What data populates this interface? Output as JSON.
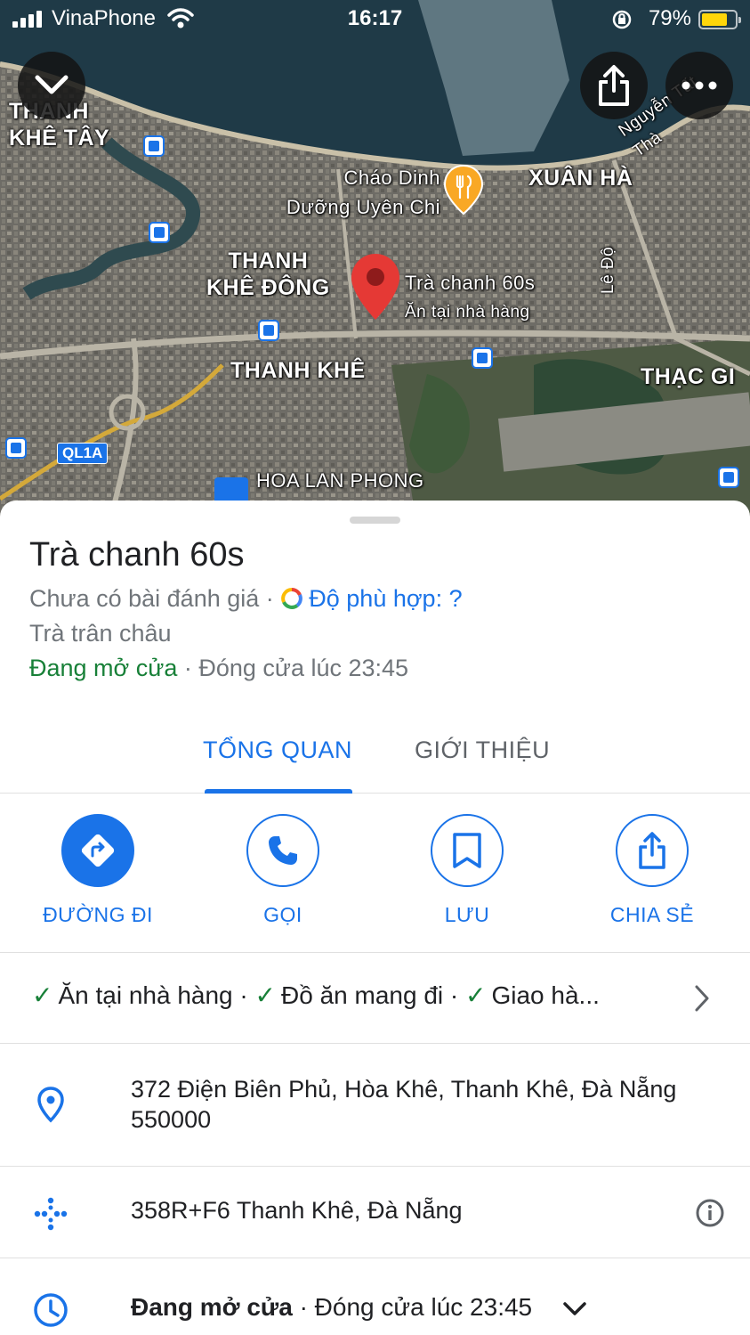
{
  "status_bar": {
    "carrier": "VinaPhone",
    "time": "16:17",
    "battery_percent": "79%",
    "battery_level": 0.79,
    "battery_color": "#ffd60a"
  },
  "map": {
    "labels": {
      "thanh_khe_tay": "THANH\nKHÊ TÂY",
      "chao_dinh_duong": "Cháo Dinh\nDưỡng Uyên Chi",
      "xuan_ha": "XUÂN HÀ",
      "nguyen_tat_thanh": "Nguyễn Tất Thà",
      "thanh_khe_dong": "THANH\nKHÊ ĐÔNG",
      "place_pin_name": "Trà chanh 60s",
      "place_pin_category": "Ăn tại nhà hàng",
      "le_do": "Lê Độ",
      "thanh_khe": "THANH KHÊ",
      "thac_gian": "THẠC GI",
      "ql1a": "QL1A",
      "hoa_lan_phong": "HOA LAN PHONG"
    },
    "pin_color": "#e53935",
    "restaurant_pin_color": "#f9a825"
  },
  "place": {
    "name": "Trà chanh 60s",
    "reviews": "Chưa có bài đánh giá ·",
    "fit_label": "Độ phù hợp: ?",
    "category": "Trà trân châu",
    "open_status": "Đang mở cửa",
    "close_time": "· Đóng cửa lúc 23:45"
  },
  "tabs": [
    {
      "label": "TỔNG QUAN",
      "active": true
    },
    {
      "label": "GIỚI THIỆU",
      "active": false
    }
  ],
  "actions": [
    {
      "label": "ĐƯỜNG ĐI",
      "icon": "directions-icon"
    },
    {
      "label": "GỌI",
      "icon": "phone-icon"
    },
    {
      "label": "LƯU",
      "icon": "bookmark-icon"
    },
    {
      "label": "CHIA SẺ",
      "icon": "share-icon"
    }
  ],
  "services": {
    "dine_in": "Ăn tại nhà hàng",
    "sep1": "·",
    "takeaway": "Đồ ăn mang đi",
    "sep2": "·",
    "delivery": "Giao hà..."
  },
  "address": "372 Điện Biên Phủ, Hòa Khê, Thanh Khê, Đà Nẵng 550000",
  "plus_code": "358R+F6 Thanh Khê, Đà Nẵng",
  "hours": {
    "open_status": "Đang mở cửa",
    "close_time": "· Đóng cửa lúc 23:45"
  },
  "colors": {
    "accent": "#1a73e8",
    "open_green": "#188038",
    "secondary_text": "#70757a"
  }
}
